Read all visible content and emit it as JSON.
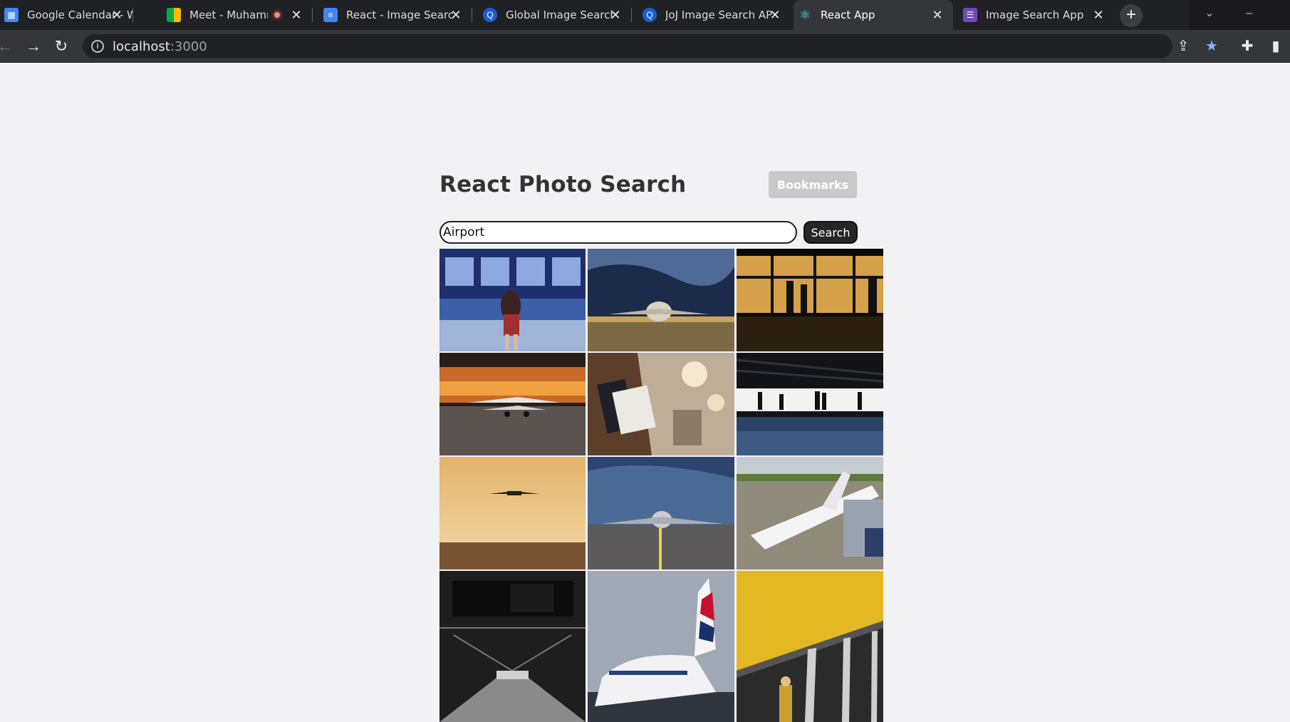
{
  "browser": {
    "tabs": [
      {
        "title": "Google Calendar - We",
        "icon": "calendar-icon"
      },
      {
        "title": "Meet - Muhammad",
        "icon": "meet-icon"
      },
      {
        "title": "React - Image Search",
        "icon": "docs-icon"
      },
      {
        "title": "Global Image Search",
        "icon": "search-q-icon"
      },
      {
        "title": "JoJ Image Search API",
        "icon": "search-q-icon"
      },
      {
        "title": "React App",
        "icon": "react-icon",
        "active": true
      },
      {
        "title": "Image Search App",
        "icon": "forms-icon"
      }
    ],
    "url_host": "localhost",
    "url_port": ":3000"
  },
  "app": {
    "title": "React Photo Search",
    "bookmarks_label": "Bookmarks",
    "search_value": "Airport",
    "search_label": "Search"
  },
  "colors": {
    "page_bg": "#f2f1f4",
    "primary_button": "#262626",
    "disabled_button": "#c9c9c9"
  },
  "photos": [
    {
      "alt": "traveler at departure board"
    },
    {
      "alt": "cargo plane under dramatic sky"
    },
    {
      "alt": "silhouettes at terminal window"
    },
    {
      "alt": "biplane at sunset"
    },
    {
      "alt": "hand holding passport and ticket"
    },
    {
      "alt": "silhouettes in terminal hall"
    },
    {
      "alt": "plane landing at dusk"
    },
    {
      "alt": "jet on runway"
    },
    {
      "alt": "plane at gate with jet bridge"
    },
    {
      "alt": "airport corridor with info screen"
    },
    {
      "alt": "British Airways tail fin"
    },
    {
      "alt": "yellow ceiling terminal"
    }
  ]
}
